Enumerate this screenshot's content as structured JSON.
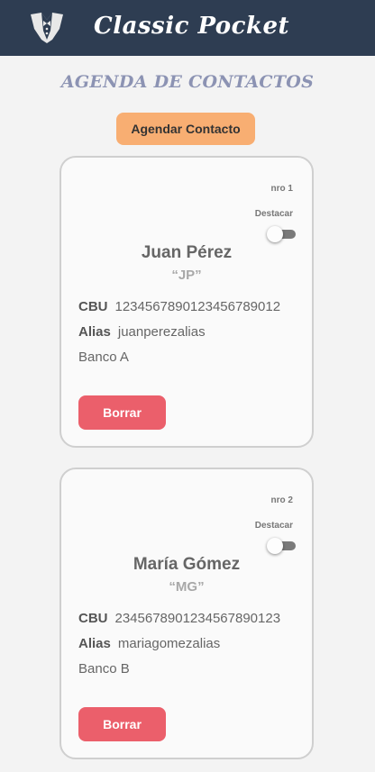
{
  "app": {
    "title": "Classic Pocket",
    "logo_icon": "tuxedo-icon"
  },
  "page": {
    "title": "AGENDA DE CONTACTOS"
  },
  "actions": {
    "add_contact_label": "Agendar Contacto"
  },
  "labels": {
    "highlight": "Destacar",
    "cbu": "CBU",
    "alias": "Alias",
    "delete": "Borrar"
  },
  "contacts": [
    {
      "number": "nro 1",
      "name": "Juan Pérez",
      "initials": "“JP”",
      "cbu": "1234567890123456789012",
      "alias": "juanperezalias",
      "bank": "Banco A",
      "highlighted": false
    },
    {
      "number": "nro 2",
      "name": "María Gómez",
      "initials": "“MG”",
      "cbu": "2345678901234567890123",
      "alias": "mariagomezalias",
      "bank": "Banco B",
      "highlighted": false
    }
  ],
  "colors": {
    "header_bg": "#2e3d52",
    "title": "#8c93b3",
    "add_button": "#f8ae72",
    "delete_button": "#eb5f6b"
  }
}
